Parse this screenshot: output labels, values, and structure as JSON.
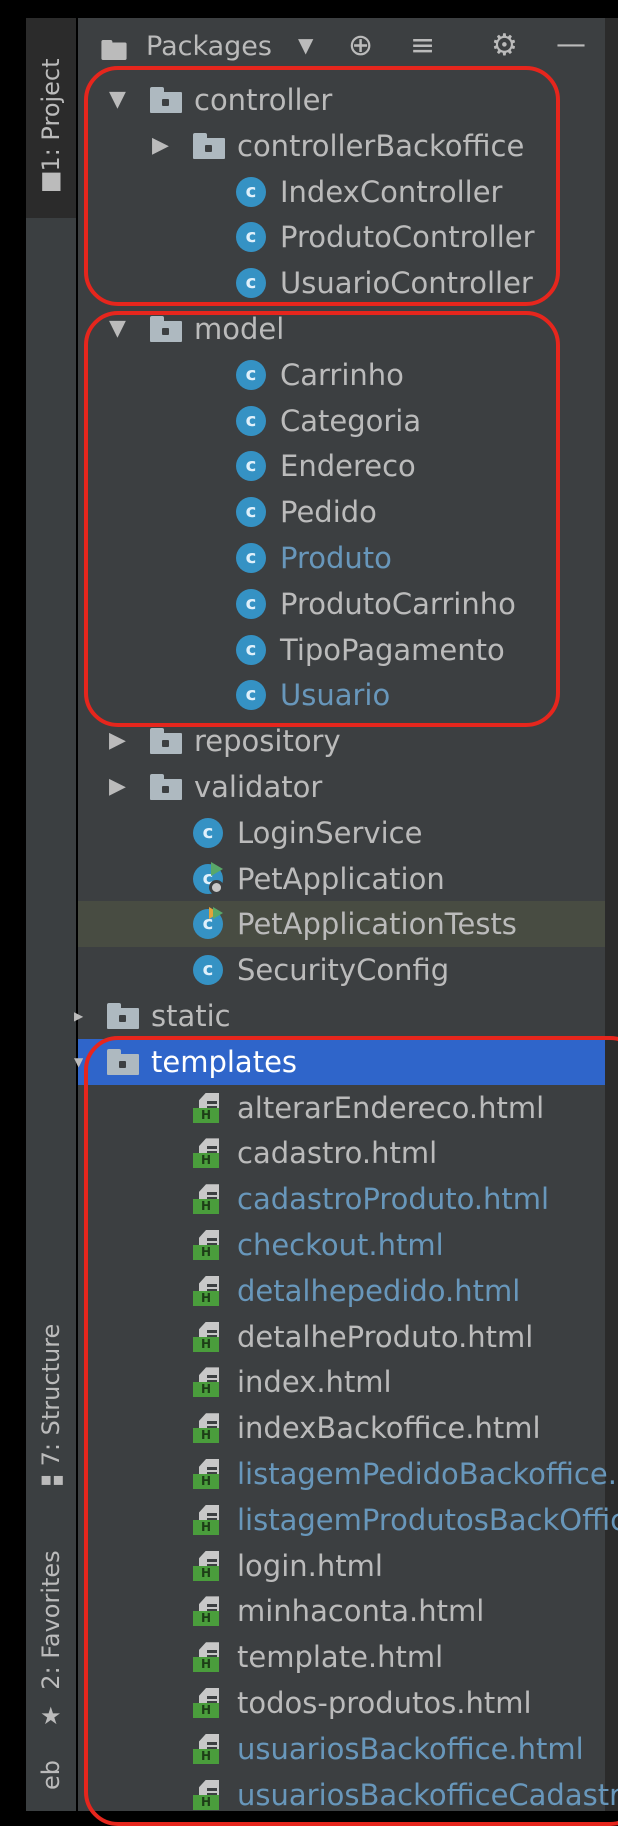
{
  "sidebar": {
    "project_tab": "1: Project",
    "structure_tab": "7: Structure",
    "favorites_tab": "2: Favorites",
    "web_tab": "eb"
  },
  "toolbar": {
    "view_label": "Packages",
    "view_icon": "folder-icon",
    "dropdown_icon": "chevron-down-icon",
    "locate_icon": "crosshair-icon",
    "collapse_icon": "collapse-all-icon",
    "settings_icon": "gear-icon",
    "hide_icon": "minus-icon"
  },
  "tree": [
    {
      "label": "controller",
      "type": "package",
      "expanded": true
    },
    {
      "label": "controllerBackoffice",
      "type": "package",
      "expanded": false
    },
    {
      "label": "IndexController",
      "type": "class"
    },
    {
      "label": "ProdutoController",
      "type": "class"
    },
    {
      "label": "UsuarioController",
      "type": "class"
    },
    {
      "label": "model",
      "type": "package",
      "expanded": true
    },
    {
      "label": "Carrinho",
      "type": "class"
    },
    {
      "label": "Categoria",
      "type": "class"
    },
    {
      "label": "Endereco",
      "type": "class"
    },
    {
      "label": "Pedido",
      "type": "class"
    },
    {
      "label": "Produto",
      "type": "class",
      "modified": true
    },
    {
      "label": "ProdutoCarrinho",
      "type": "class"
    },
    {
      "label": "TipoPagamento",
      "type": "class"
    },
    {
      "label": "Usuario",
      "type": "class",
      "modified": true
    },
    {
      "label": "repository",
      "type": "package",
      "expanded": false
    },
    {
      "label": "validator",
      "type": "package",
      "expanded": false
    },
    {
      "label": "LoginService",
      "type": "class"
    },
    {
      "label": "PetApplication",
      "type": "app"
    },
    {
      "label": "PetApplicationTests",
      "type": "test"
    },
    {
      "label": "SecurityConfig",
      "type": "class"
    },
    {
      "label": "static",
      "type": "folder",
      "expanded": false
    },
    {
      "label": "templates",
      "type": "folder",
      "expanded": true,
      "selected": true
    },
    {
      "label": "alterarEndereco.html",
      "type": "html"
    },
    {
      "label": "cadastro.html",
      "type": "html"
    },
    {
      "label": "cadastroProduto.html",
      "type": "html",
      "modified": true
    },
    {
      "label": "checkout.html",
      "type": "html",
      "modified": true
    },
    {
      "label": "detalhepedido.html",
      "type": "html",
      "modified": true
    },
    {
      "label": "detalheProduto.html",
      "type": "html"
    },
    {
      "label": "index.html",
      "type": "html"
    },
    {
      "label": "indexBackoffice.html",
      "type": "html"
    },
    {
      "label": "listagemPedidoBackoffice.ht",
      "type": "html",
      "modified": true
    },
    {
      "label": "listagemProdutosBackOffice",
      "type": "html",
      "modified": true
    },
    {
      "label": "login.html",
      "type": "html"
    },
    {
      "label": "minhaconta.html",
      "type": "html"
    },
    {
      "label": "template.html",
      "type": "html"
    },
    {
      "label": "todos-produtos.html",
      "type": "html"
    },
    {
      "label": "usuariosBackoffice.html",
      "type": "html",
      "modified": true
    },
    {
      "label": "usuariosBackofficeCadastro",
      "type": "html",
      "modified": true
    }
  ],
  "colors": {
    "annotation": "#e6261d",
    "selection": "#2f65ca",
    "modified_text": "#6897bb",
    "text": "#bbbbbb"
  }
}
